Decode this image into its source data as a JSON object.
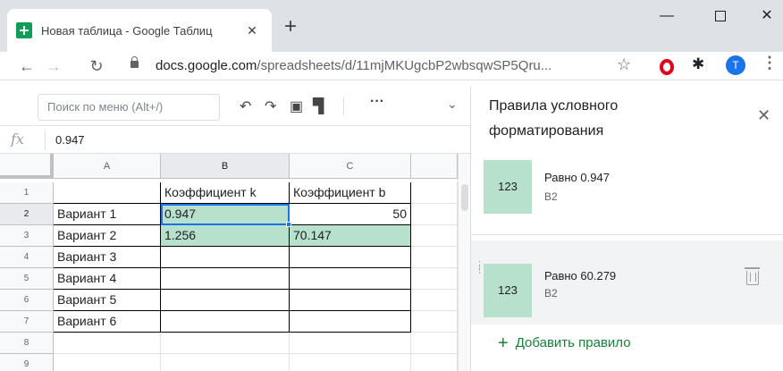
{
  "browser": {
    "tab_title": "Новая таблица - Google Таблиц",
    "tab_close": "✕",
    "new_tab": "+",
    "url_host": "docs.google.com",
    "url_path": "/spreadsheets/d/11mjMKUgcbP2wbsqwSP5Qru...",
    "avatar_letter": "T",
    "window_min": "—",
    "window_close": "✕"
  },
  "sheets": {
    "menu_search_placeholder": "Поиск по меню (Alt+/)",
    "more_label": "···",
    "formula_fx": "fx",
    "formula_value": "0.947"
  },
  "grid": {
    "columns": [
      "A",
      "B",
      "C"
    ],
    "rows": [
      "1",
      "2",
      "3",
      "4",
      "5",
      "6",
      "7",
      "8",
      "9"
    ],
    "cells": {
      "B1": "Коэффициент k",
      "C1": "Коэффициент b",
      "A2": "Вариант 1",
      "B2": "0.947",
      "C2": "50",
      "A3": "Вариант 2",
      "B3": "1.256",
      "C3": "70.147",
      "A4": "Вариант 3",
      "A5": "Вариант 4",
      "A6": "Вариант 5",
      "A7": "Вариант 6"
    },
    "highlight_color": "#b7e1cd",
    "selected_cell": "B2"
  },
  "panel": {
    "title": "Правила условного форматирования",
    "close": "✕",
    "rules": [
      {
        "swatch": "123",
        "condition": "Равно 0.947",
        "range": "B2"
      },
      {
        "swatch": "123",
        "condition": "Равно 60.279",
        "range": "B2"
      }
    ],
    "add_rule": "Добавить правило"
  }
}
